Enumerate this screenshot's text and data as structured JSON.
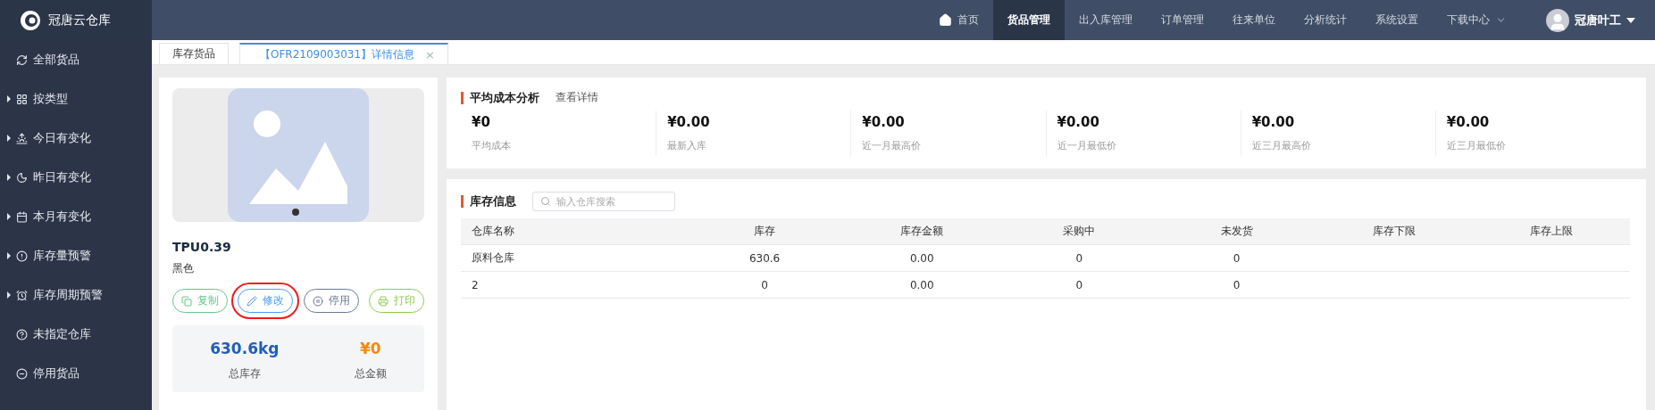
{
  "app": {
    "name": "冠唐云仓库"
  },
  "nav": [
    {
      "label": "首页",
      "selected": false,
      "dropdown": false
    },
    {
      "label": "货品管理",
      "selected": true,
      "dropdown": false
    },
    {
      "label": "出入库管理",
      "selected": false,
      "dropdown": false
    },
    {
      "label": "订单管理",
      "selected": false,
      "dropdown": false
    },
    {
      "label": "往来单位",
      "selected": false,
      "dropdown": false
    },
    {
      "label": "分析统计",
      "selected": false,
      "dropdown": false
    },
    {
      "label": "系统设置",
      "selected": false,
      "dropdown": false
    },
    {
      "label": "下载中心",
      "selected": false,
      "dropdown": true
    }
  ],
  "user": {
    "name": "冠唐叶工"
  },
  "sidebar": {
    "items": [
      {
        "label": "全部货品",
        "expandable": false
      },
      {
        "label": "按类型",
        "expandable": true
      },
      {
        "label": "今日有变化",
        "expandable": true
      },
      {
        "label": "昨日有变化",
        "expandable": true
      },
      {
        "label": "本月有变化",
        "expandable": true
      },
      {
        "label": "库存量预警",
        "expandable": true
      },
      {
        "label": "库存周期预警",
        "expandable": true
      },
      {
        "label": "未指定仓库",
        "expandable": false
      },
      {
        "label": "停用货品",
        "expandable": false
      }
    ]
  },
  "tabs": [
    {
      "label": "库存货品",
      "selected": false
    },
    {
      "label": "【OFR2109003031】详情信息",
      "selected": true,
      "close": "×"
    }
  ],
  "product": {
    "name": "TPU0.39",
    "variant": "黑色",
    "actions": [
      {
        "label": "复制",
        "color": "#67c58a",
        "highlighted": false
      },
      {
        "label": "修改",
        "color": "#4a9cf5",
        "highlighted": true
      },
      {
        "label": "停用",
        "color": "#6a7896",
        "highlighted": false
      },
      {
        "label": "打印",
        "color": "#8ccc52",
        "highlighted": false
      }
    ],
    "stats": [
      {
        "value": "630.6kg",
        "label": "总库存",
        "color": "#1f5fb8"
      },
      {
        "value": "¥0",
        "label": "总金额",
        "color": "#f08a14"
      }
    ]
  },
  "cost_analysis": {
    "title": "平均成本分析",
    "link": "查看详情",
    "metrics": [
      {
        "value": "¥0",
        "label": "平均成本"
      },
      {
        "value": "¥0.00",
        "label": "最新入库"
      },
      {
        "value": "¥0.00",
        "label": "近一月最高价"
      },
      {
        "value": "¥0.00",
        "label": "近一月最低价"
      },
      {
        "value": "¥0.00",
        "label": "近三月最高价"
      },
      {
        "value": "¥0.00",
        "label": "近三月最低价"
      }
    ]
  },
  "inventory": {
    "title": "库存信息",
    "search": {
      "placeholder": "输入仓库搜索"
    },
    "columns": [
      "仓库名称",
      "库存",
      "库存金额",
      "采购中",
      "未发货",
      "库存下限",
      "库存上限"
    ],
    "rows": [
      [
        "原料仓库",
        "630.6",
        "0.00",
        "0",
        "0"
      ],
      [
        "2",
        "0",
        "0.00",
        "0",
        "0"
      ]
    ]
  }
}
